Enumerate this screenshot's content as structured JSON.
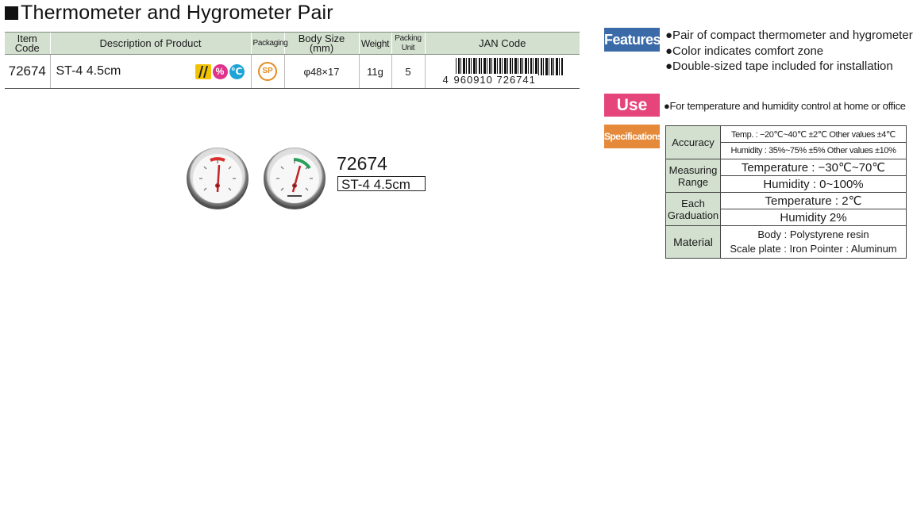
{
  "title": "Thermometer and Hygrometer Pair",
  "table": {
    "headers": {
      "item_code": "Item Code",
      "description": "Description of Product",
      "packaging": "Packaging",
      "body_size": "Body Size (mm)",
      "weight": "Weight",
      "packing_unit": "Packing Unit",
      "jan_code": "JAN Code"
    },
    "row": {
      "item_code": "72674",
      "description": "ST-4  4.5cm",
      "packaging_icon": "SP",
      "body_size": "φ48×17",
      "weight": "11g",
      "packing_unit": "5",
      "jan_first": "4",
      "jan_rest": "960910 726741"
    },
    "icons": {
      "tape": "tape-icon",
      "humidity": "%",
      "temperature": "℃"
    }
  },
  "photo": {
    "item_number": "72674",
    "model": "ST-4 4.5cm"
  },
  "panel": {
    "features_label": "Features",
    "features": [
      "●Pair of compact thermometer and hygrometer",
      "●Color indicates comfort zone",
      "●Double-sized tape included for installation"
    ],
    "use_label": "Use",
    "use_text": "●For temperature and humidity control at home or office",
    "spec_label": "Specifications",
    "specs": {
      "accuracy_label": "Accuracy",
      "accuracy_temp": "Temp. : −20℃~40℃  ±2℃  Other values  ±4℃",
      "accuracy_hum": "Humidity : 35%~75%  ±5%  Other values  ±10%",
      "range_label": "Measuring Range",
      "range_temp": "Temperature : −30℃~70℃",
      "range_hum": "Humidity : 0~100%",
      "graduation_label": "Each Graduation",
      "graduation_temp": "Temperature : 2℃",
      "graduation_hum": "Humidity 2%",
      "material_label": "Material",
      "material_body": "Body : Polystyrene resin",
      "material_plate": "Scale plate : Iron   Pointer : Aluminum"
    }
  },
  "colors": {
    "header_bg": "#d3e0cf",
    "features_tag": "#3a6aa8",
    "use_tag": "#e5457a",
    "spec_tag": "#e58a3a",
    "thermo_arc": "#d9302f",
    "hygro_arc": "#2aa05a"
  }
}
